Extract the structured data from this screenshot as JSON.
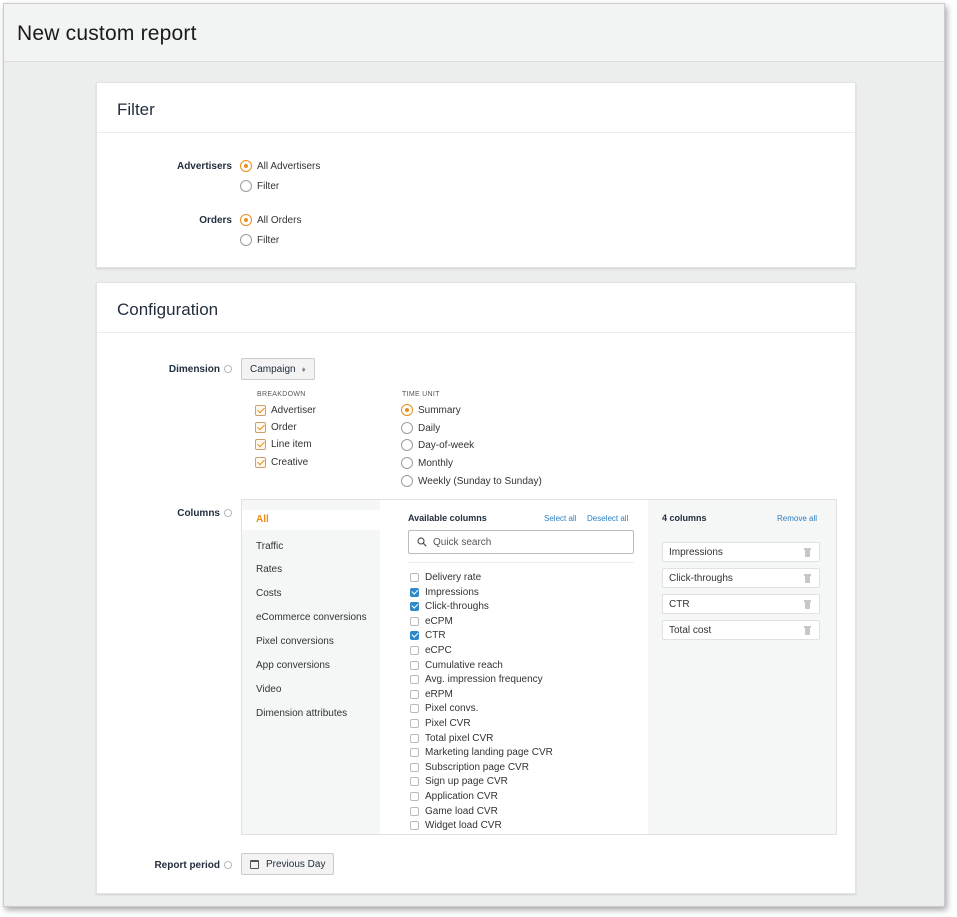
{
  "page": {
    "title": "New custom report"
  },
  "filter": {
    "heading": "Filter",
    "advertisers": {
      "label": "Advertisers",
      "options": [
        "All Advertisers",
        "Filter"
      ],
      "selected": 0
    },
    "orders": {
      "label": "Orders",
      "options": [
        "All Orders",
        "Filter"
      ],
      "selected": 0
    }
  },
  "configuration": {
    "heading": "Configuration",
    "dimension": {
      "label": "Dimension",
      "value": "Campaign",
      "caret": "♦",
      "breakdown_title": "BREAKDOWN",
      "breakdown": [
        "Advertiser",
        "Order",
        "Line item",
        "Creative"
      ],
      "time_unit_title": "TIME UNIT",
      "time_units": [
        "Summary",
        "Daily",
        "Day-of-week",
        "Monthly",
        "Weekly (Sunday to Sunday)"
      ],
      "time_unit_selected": 0
    },
    "columns": {
      "label": "Columns",
      "categories": [
        "All",
        "Traffic",
        "Rates",
        "Costs",
        "eCommerce conversions",
        "Pixel conversions",
        "App conversions",
        "Video",
        "Dimension attributes"
      ],
      "active_category": 0,
      "available_title": "Available columns",
      "select_all": "Select all",
      "deselect_all": "Deselect all",
      "search_placeholder": "Quick search",
      "available": [
        {
          "name": "Delivery rate",
          "checked": false
        },
        {
          "name": "Impressions",
          "checked": true
        },
        {
          "name": "Click-throughs",
          "checked": true
        },
        {
          "name": "eCPM",
          "checked": false
        },
        {
          "name": "CTR",
          "checked": true
        },
        {
          "name": "eCPC",
          "checked": false
        },
        {
          "name": "Cumulative reach",
          "checked": false
        },
        {
          "name": "Avg. impression frequency",
          "checked": false
        },
        {
          "name": "eRPM",
          "checked": false
        },
        {
          "name": "Pixel convs.",
          "checked": false
        },
        {
          "name": "Pixel CVR",
          "checked": false
        },
        {
          "name": "Total pixel CVR",
          "checked": false
        },
        {
          "name": "Marketing landing page CVR",
          "checked": false
        },
        {
          "name": "Subscription page CVR",
          "checked": false
        },
        {
          "name": "Sign up page CVR",
          "checked": false
        },
        {
          "name": "Application CVR",
          "checked": false
        },
        {
          "name": "Game load CVR",
          "checked": false
        },
        {
          "name": "Widget load CVR",
          "checked": false
        }
      ],
      "selected_title": "4 columns",
      "remove_all": "Remove all",
      "selected": [
        "Impressions",
        "Click-throughs",
        "CTR",
        "Total cost"
      ]
    },
    "report_period": {
      "label": "Report period",
      "value": "Previous Day"
    }
  },
  "colors": {
    "accent": "#e88e1b",
    "check_blue": "#2d87c8",
    "link": "#2d7fc1"
  },
  "icons": {
    "info": "info-icon",
    "search": "search-icon",
    "calendar": "calendar-icon",
    "trash": "trash-icon"
  }
}
